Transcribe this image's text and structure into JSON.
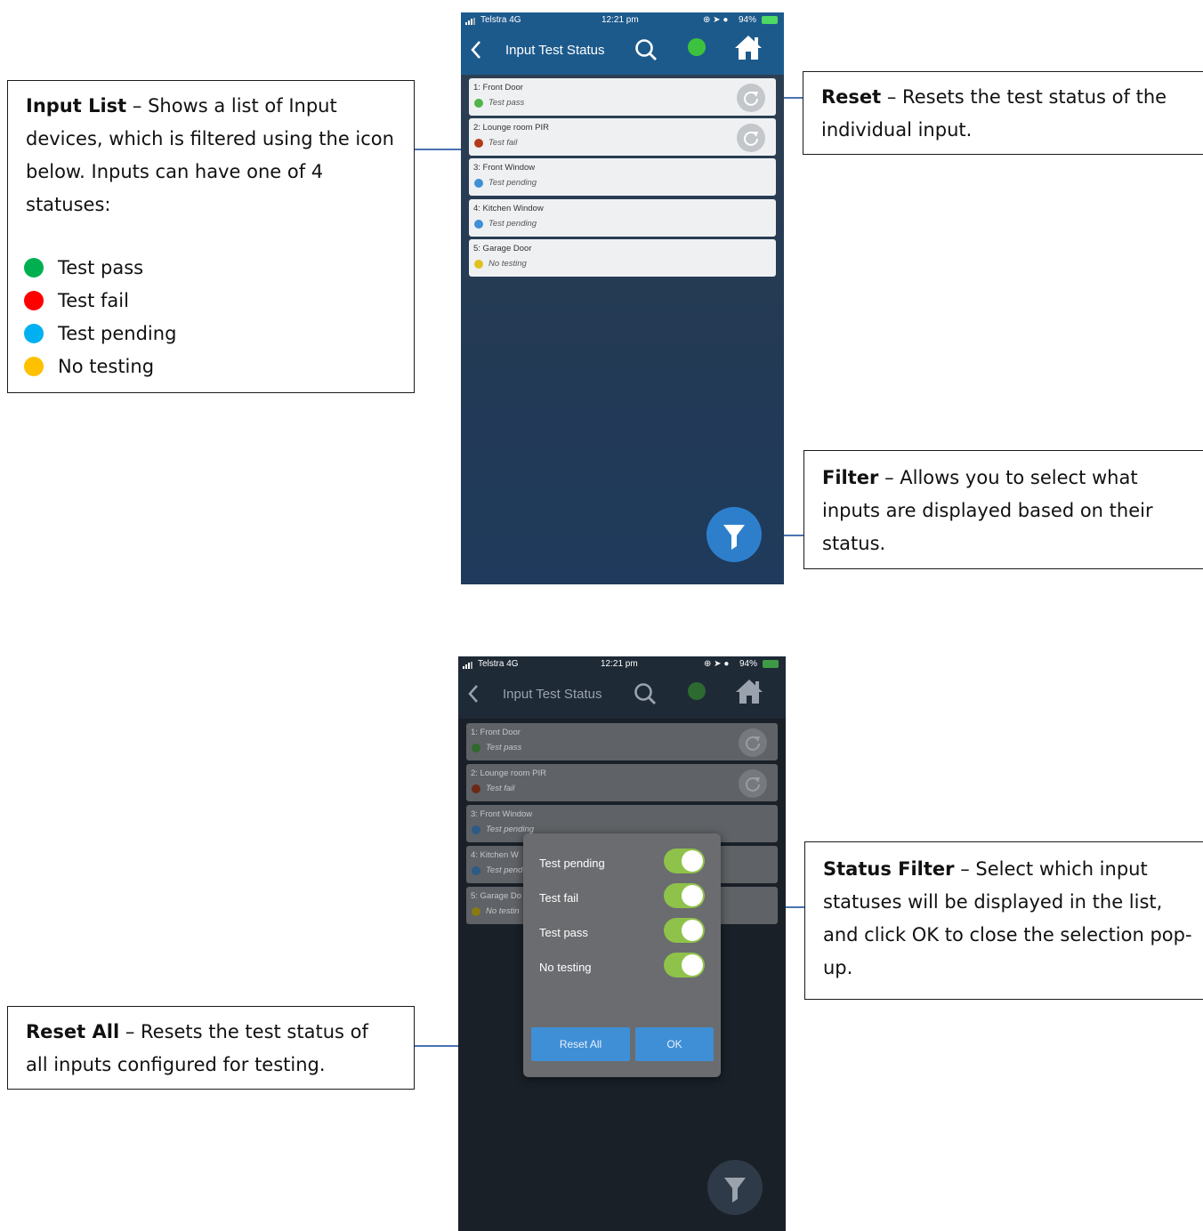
{
  "phone_top": {
    "status": {
      "carrier": "Telstra  4G",
      "time": "12:21 pm",
      "battery": "94%"
    },
    "title": "Input Test Status",
    "connection_color": "#3cc23f",
    "inputs": [
      {
        "name": "1: Front Door",
        "status": "Test pass",
        "color": "#4fb548",
        "reset": true
      },
      {
        "name": "2: Lounge room PIR",
        "status": "Test fail",
        "color": "#b33a1a",
        "reset": true
      },
      {
        "name": "3: Front Window",
        "status": "Test pending",
        "color": "#3f8fd6",
        "reset": false
      },
      {
        "name": "4: Kitchen Window",
        "status": "Test pending",
        "color": "#3f8fd6",
        "reset": false
      },
      {
        "name": "5: Garage Door",
        "status": "No testing",
        "color": "#e0c21e",
        "reset": false
      }
    ]
  },
  "phone_bottom": {
    "status": {
      "carrier": "Telstra  4G",
      "time": "12:21 pm",
      "battery": "94%"
    },
    "title": "Input Test Status",
    "inputs": [
      {
        "name": "1: Front Door",
        "status": "Test pass"
      },
      {
        "name": "2: Lounge room PIR",
        "status": "Test fail"
      },
      {
        "name": "3: Front Window",
        "status": "Test pending"
      },
      {
        "name": "4: Kitchen W",
        "status": "Test pend"
      },
      {
        "name": "5: Garage Do",
        "status": "No testin"
      }
    ],
    "filter_modal": {
      "toggles": [
        {
          "label": "Test pending",
          "on": true
        },
        {
          "label": "Test fail",
          "on": true
        },
        {
          "label": "Test pass",
          "on": true
        },
        {
          "label": "No testing",
          "on": true
        }
      ],
      "reset_all_label": "Reset All",
      "ok_label": "OK"
    }
  },
  "callouts": {
    "input_list": {
      "title": "Input List",
      "text": " – Shows a list of Input devices, which is filtered using the icon below. Inputs can have one of 4 statuses:",
      "legend": [
        {
          "label": "Test pass",
          "color": "#00b050"
        },
        {
          "label": "Test fail",
          "color": "#ff0000"
        },
        {
          "label": "Test pending",
          "color": "#00b0f0"
        },
        {
          "label": "No testing",
          "color": "#ffc000"
        }
      ]
    },
    "reset": {
      "title": "Reset",
      "text": " – Resets the test status of the individual input."
    },
    "filter": {
      "title": "Filter",
      "text": " – Allows you to select what inputs are displayed based on their status."
    },
    "status_filter": {
      "title": "Status Filter",
      "text": " – Select which input statuses will be displayed in the list, and click OK to close the selection pop-up."
    },
    "reset_all": {
      "title": "Reset All",
      "text": " – Resets the test status of all inputs configured for testing."
    }
  }
}
